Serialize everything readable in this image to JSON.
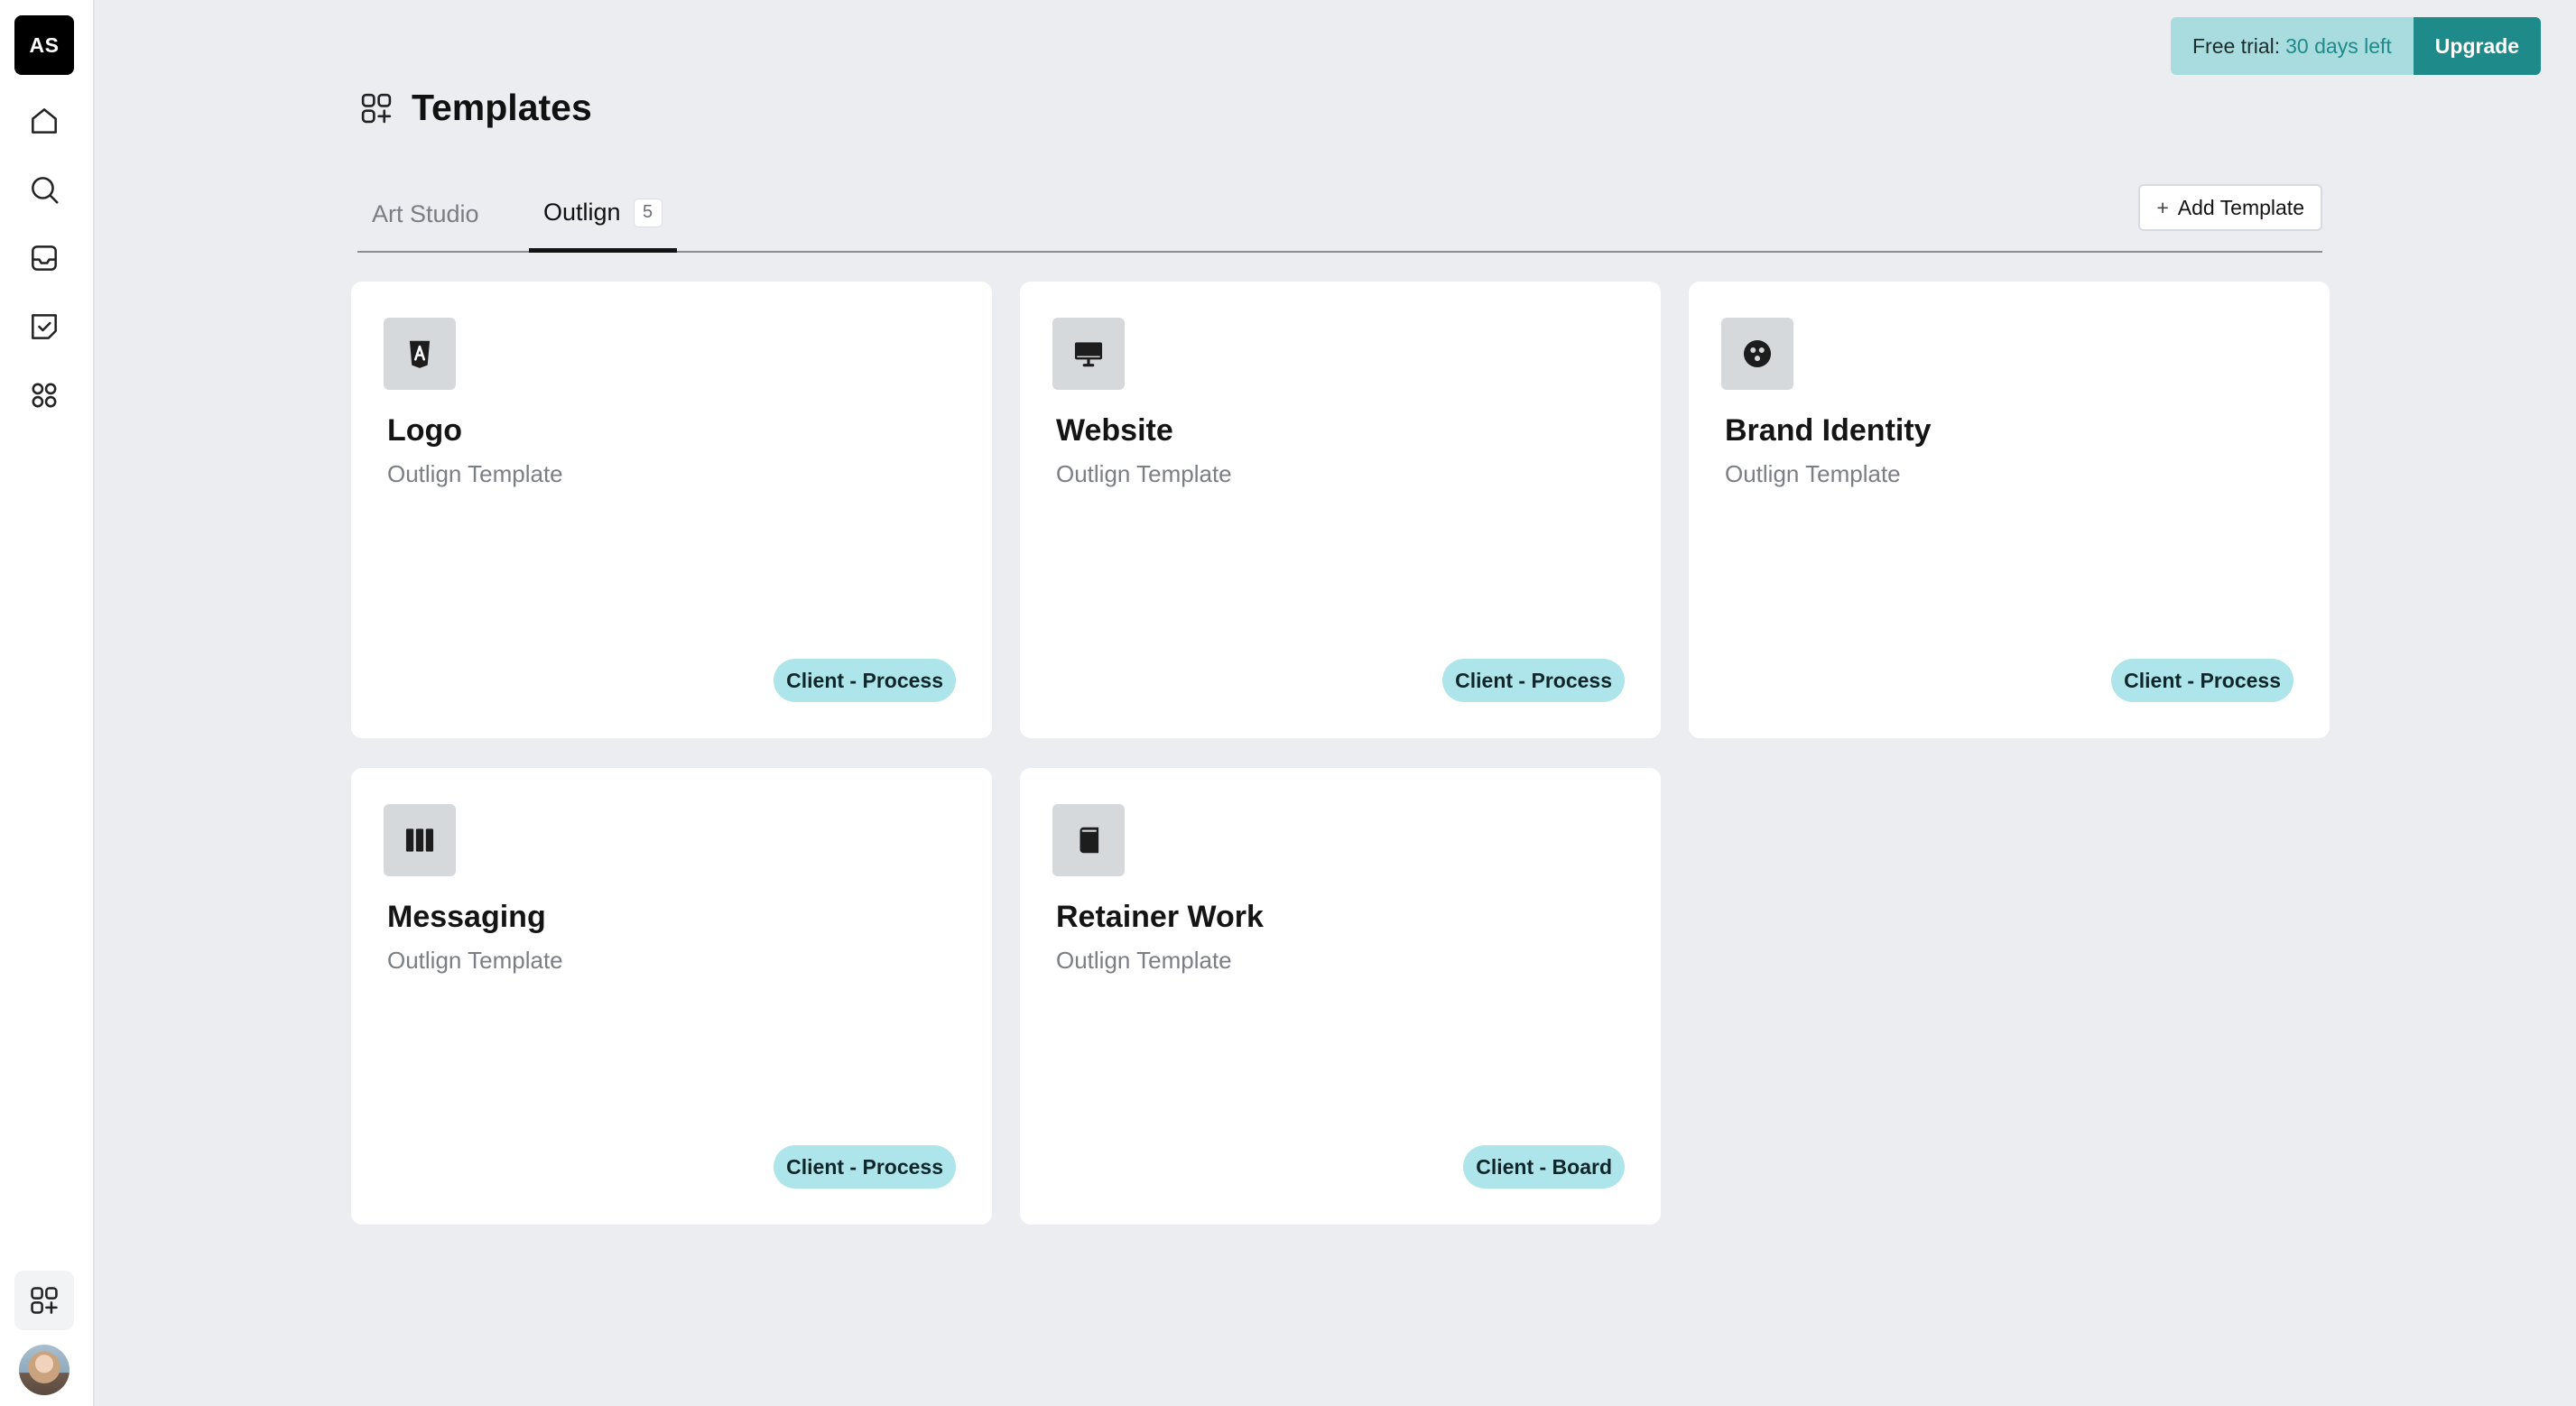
{
  "workspace": {
    "initials": "AS"
  },
  "trial": {
    "label": "Free trial:",
    "days": "30 days left",
    "upgrade_label": "Upgrade"
  },
  "page": {
    "title": "Templates"
  },
  "tabs": [
    {
      "label": "Art Studio"
    },
    {
      "label": "Outlign",
      "count": "5"
    }
  ],
  "add_template_label": "Add Template",
  "cards": [
    {
      "title": "Logo",
      "subtitle": "Outlign Template",
      "tag": "Client - Process",
      "icon": "logo-icon"
    },
    {
      "title": "Website",
      "subtitle": "Outlign Template",
      "tag": "Client - Process",
      "icon": "monitor-icon"
    },
    {
      "title": "Brand Identity",
      "subtitle": "Outlign Template",
      "tag": "Client - Process",
      "icon": "palette-icon"
    },
    {
      "title": "Messaging",
      "subtitle": "Outlign Template",
      "tag": "Client - Process",
      "icon": "columns-icon"
    },
    {
      "title": "Retainer Work",
      "subtitle": "Outlign Template",
      "tag": "Client - Board",
      "icon": "book-icon"
    }
  ],
  "colors": {
    "accent": "#1f8a8a",
    "trial_bg": "#a8dcde",
    "tag_bg": "#ade5ea",
    "page_bg": "#ebedf0"
  }
}
